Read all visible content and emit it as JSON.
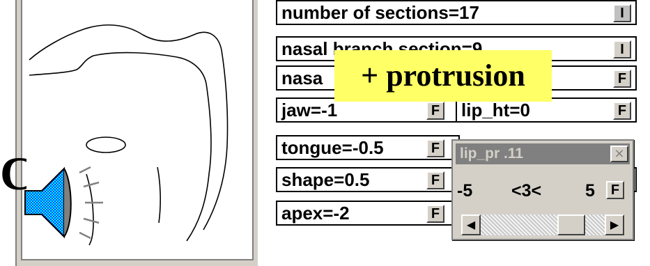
{
  "partial_char": "C",
  "rows": [
    {
      "id": "sections",
      "label": "number of sections=17",
      "button": "I"
    },
    {
      "id": "nasal-branch",
      "label": "nasal branch section=9",
      "button": "I"
    },
    {
      "id": "nasal-area",
      "label": "nasa",
      "button": "F"
    },
    {
      "id": "jaw",
      "label": "jaw=-1",
      "button": "F"
    },
    {
      "id": "lip-ht",
      "label": "lip_ht=0",
      "button": "F"
    },
    {
      "id": "tongue",
      "label": "tongue=-0.5",
      "button": "F"
    },
    {
      "id": "shape",
      "label": "shape=0.5",
      "button": "F"
    },
    {
      "id": "apex",
      "label": "apex=-2",
      "button": "F"
    }
  ],
  "dialog": {
    "title": "lip_pr .11",
    "close": "×",
    "min": "-5",
    "current": "<3<",
    "max": "5",
    "button": "F",
    "slider": {
      "min": -5,
      "max": 5,
      "value": 3
    },
    "left_arrow": "◀",
    "right_arrow": "▶"
  },
  "callout": "+ protrusion",
  "colors": {
    "callout_bg": "#ffff66",
    "panel_gray": "#d4d0c8",
    "title_bar": "#808080"
  }
}
